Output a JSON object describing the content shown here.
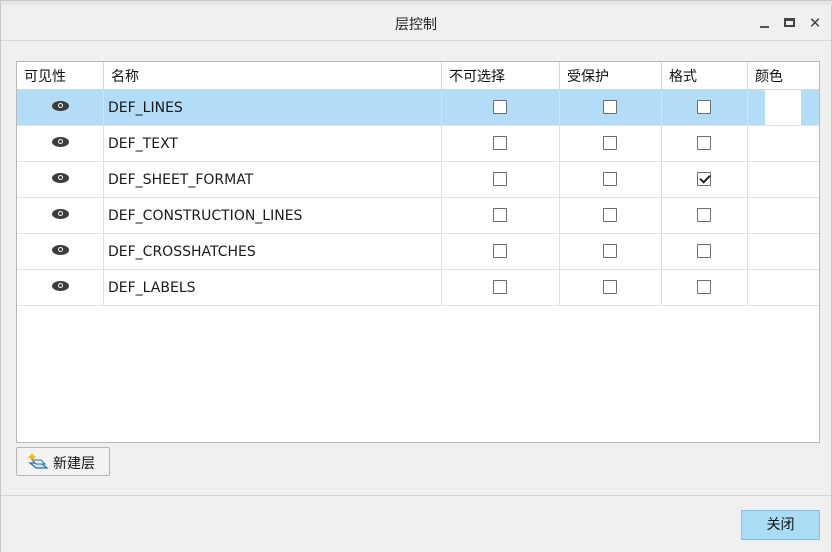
{
  "window": {
    "title": "层控制",
    "controls": [
      "minimize-icon",
      "maximize-icon",
      "close-icon"
    ],
    "close_glyph": "✕"
  },
  "table": {
    "headers": {
      "visibility": "可见性",
      "name": "名称",
      "not_selectable": "不可选择",
      "protected": "受保护",
      "format": "格式",
      "color": "颜色"
    },
    "rows": [
      {
        "name": "DEF_LINES",
        "visible": true,
        "not_selectable": false,
        "protected": false,
        "format": false,
        "selected": true,
        "color": "#ffffff"
      },
      {
        "name": "DEF_TEXT",
        "visible": true,
        "not_selectable": false,
        "protected": false,
        "format": false,
        "selected": false
      },
      {
        "name": "DEF_SHEET_FORMAT",
        "visible": true,
        "not_selectable": false,
        "protected": false,
        "format": true,
        "selected": false
      },
      {
        "name": "DEF_CONSTRUCTION_LINES",
        "visible": true,
        "not_selectable": false,
        "protected": false,
        "format": false,
        "selected": false
      },
      {
        "name": "DEF_CROSSHATCHES",
        "visible": true,
        "not_selectable": false,
        "protected": false,
        "format": false,
        "selected": false
      },
      {
        "name": "DEF_LABELS",
        "visible": true,
        "not_selectable": false,
        "protected": false,
        "format": false,
        "selected": false
      }
    ]
  },
  "actions": {
    "new_layer": "新建层",
    "close": "关闭"
  },
  "colors": {
    "selected_row": "#b3dcf6",
    "primary_button": "#a9dcf5"
  }
}
